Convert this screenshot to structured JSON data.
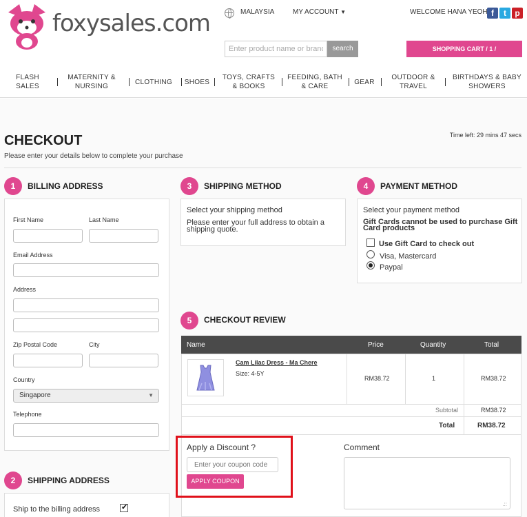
{
  "brand": {
    "name": "foxysales.com",
    "accent": "#e0478f"
  },
  "topbar": {
    "country": "MALAYSIA",
    "account": "MY ACCOUNT",
    "welcome": "WELCOME HANA YEOH!",
    "social_icons": [
      "facebook-icon",
      "twitter-icon",
      "pinterest-icon"
    ]
  },
  "search": {
    "placeholder": "Enter product name or brand",
    "button": "search"
  },
  "cart": {
    "label": "SHOPPING CART / 1 /"
  },
  "categories": [
    "FLASH SALES",
    "MATERNITY & NURSING",
    "CLOTHING",
    "SHOES",
    "TOYS, CRAFTS & BOOKS",
    "FEEDING, BATH & CARE",
    "GEAR",
    "OUTDOOR & TRAVEL",
    "BIRTHDAYS & BABY SHOWERS"
  ],
  "page": {
    "title": "CHECKOUT",
    "subtitle": "Please enter your details below to complete your purchase",
    "time_left": "Time left: 29 mins 47 secs"
  },
  "billing": {
    "step": "1",
    "title": "BILLING ADDRESS",
    "first_name": "First Name",
    "last_name": "Last Name",
    "email": "Email Address",
    "address": "Address",
    "zip": "Zip Postal Code",
    "city": "City",
    "country": "Country",
    "country_value": "Singapore",
    "telephone": "Telephone"
  },
  "shipping_address": {
    "step": "2",
    "title": "SHIPPING ADDRESS",
    "ship_to_billing": "Ship to the billing address"
  },
  "shipping_method": {
    "step": "3",
    "title": "SHIPPING METHOD",
    "prompt": "Select your shipping method",
    "note": "Please enter your full address to obtain a shipping quote."
  },
  "payment": {
    "step": "4",
    "title": "PAYMENT METHOD",
    "prompt": "Select your payment method",
    "warning": "Gift Cards cannot be used to purchase Gift Card products",
    "gift_card": "Use Gift Card to check out",
    "options": [
      "Visa, Mastercard",
      "Paypal"
    ],
    "selected": "Paypal"
  },
  "review": {
    "step": "5",
    "title": "CHECKOUT REVIEW",
    "columns": [
      "Name",
      "Price",
      "Quantity",
      "Total"
    ],
    "item": {
      "name": "Cam Lilac Dress - Ma Chere",
      "size": "Size: 4-5Y",
      "price": "RM38.72",
      "quantity": "1",
      "total": "RM38.72"
    },
    "subtotal_label": "Subtotal",
    "subtotal": "RM38.72",
    "total_label": "Total",
    "total": "RM38.72"
  },
  "discount": {
    "title": "Apply a Discount ?",
    "placeholder": "Enter your coupon code",
    "button": "APPLY COUPON"
  },
  "comment": {
    "title": "Comment"
  }
}
